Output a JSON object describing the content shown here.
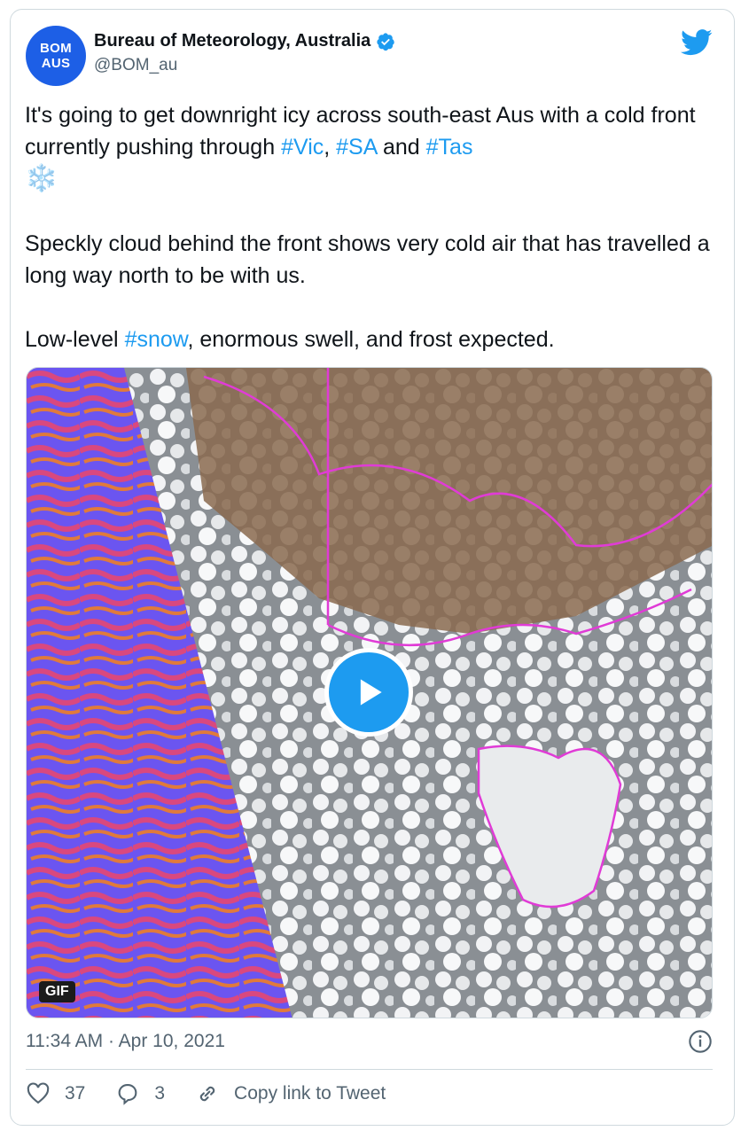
{
  "account": {
    "avatar_line1": "BOM",
    "avatar_line2": "AUS",
    "display_name": "Bureau of Meteorology, Australia",
    "handle": "@BOM_au",
    "verified": true
  },
  "tweet": {
    "p1_a": "It's going to get downright icy across south-east Aus with a cold front currently pushing through ",
    "tag_vic": "#Vic",
    "p1_b": ", ",
    "tag_sa": "#SA",
    "p1_c": " and ",
    "tag_tas": "#Tas",
    "snowflake": "❄️",
    "p2": "Speckly cloud behind the front shows very cold air that has travelled a long way north to be with us.",
    "p3_a": "Low-level ",
    "tag_snow": "#snow",
    "p3_b": ", enormous swell, and frost expected."
  },
  "media": {
    "badge": "GIF",
    "description_icon": "satellite-image"
  },
  "meta": {
    "timestamp": "11:34 AM · Apr 10, 2021"
  },
  "actions": {
    "likes": "37",
    "replies": "3",
    "copy_link": "Copy link to Tweet"
  },
  "colors": {
    "accent": "#1d9bf0",
    "avatar": "#1d5fe6",
    "secondary_text": "#536471",
    "border": "#cfd9de"
  }
}
